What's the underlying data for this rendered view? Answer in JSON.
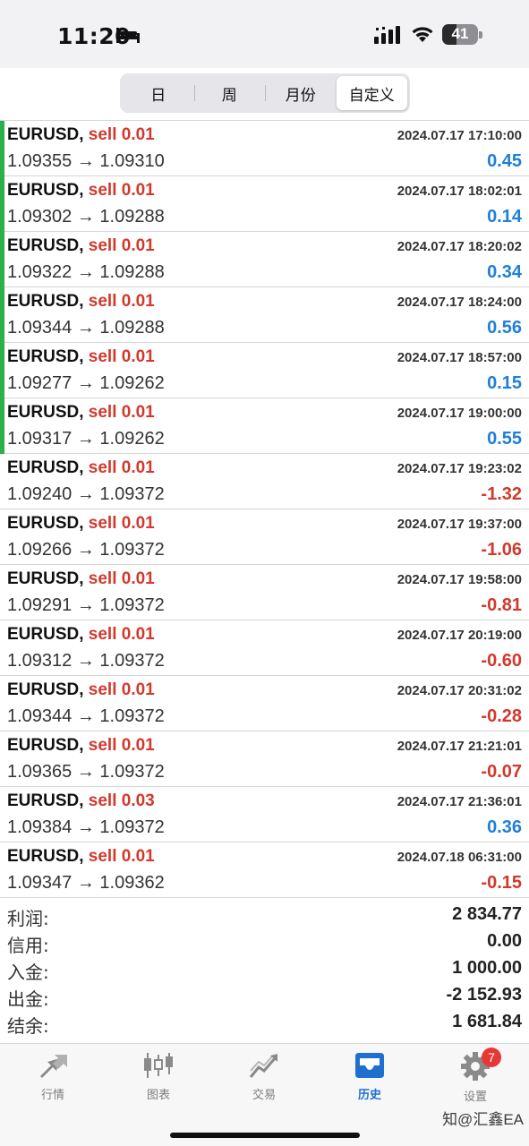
{
  "status": {
    "time": "11:20",
    "battery": "41",
    "battery_level": 0.41
  },
  "segments": [
    {
      "label": "日",
      "active": false
    },
    {
      "label": "周",
      "active": false
    },
    {
      "label": "月份",
      "active": false
    },
    {
      "label": "自定义",
      "active": true
    }
  ],
  "trades": [
    {
      "symbol": "EURUSD,",
      "side": "sell 0.01",
      "datetime": "2024.07.17 17:10:00",
      "prices": "1.09355 → 1.09310",
      "pl": "0.45",
      "profit": true
    },
    {
      "symbol": "EURUSD,",
      "side": "sell 0.01",
      "datetime": "2024.07.17 18:02:01",
      "prices": "1.09302 → 1.09288",
      "pl": "0.14",
      "profit": true
    },
    {
      "symbol": "EURUSD,",
      "side": "sell 0.01",
      "datetime": "2024.07.17 18:20:02",
      "prices": "1.09322 → 1.09288",
      "pl": "0.34",
      "profit": true
    },
    {
      "symbol": "EURUSD,",
      "side": "sell 0.01",
      "datetime": "2024.07.17 18:24:00",
      "prices": "1.09344 → 1.09288",
      "pl": "0.56",
      "profit": true
    },
    {
      "symbol": "EURUSD,",
      "side": "sell 0.01",
      "datetime": "2024.07.17 18:57:00",
      "prices": "1.09277 → 1.09262",
      "pl": "0.15",
      "profit": true
    },
    {
      "symbol": "EURUSD,",
      "side": "sell 0.01",
      "datetime": "2024.07.17 19:00:00",
      "prices": "1.09317 → 1.09262",
      "pl": "0.55",
      "profit": true
    },
    {
      "symbol": "EURUSD,",
      "side": "sell 0.01",
      "datetime": "2024.07.17 19:23:02",
      "prices": "1.09240 → 1.09372",
      "pl": "-1.32",
      "profit": false
    },
    {
      "symbol": "EURUSD,",
      "side": "sell 0.01",
      "datetime": "2024.07.17 19:37:00",
      "prices": "1.09266 → 1.09372",
      "pl": "-1.06",
      "profit": false
    },
    {
      "symbol": "EURUSD,",
      "side": "sell 0.01",
      "datetime": "2024.07.17 19:58:00",
      "prices": "1.09291 → 1.09372",
      "pl": "-0.81",
      "profit": false
    },
    {
      "symbol": "EURUSD,",
      "side": "sell 0.01",
      "datetime": "2024.07.17 20:19:00",
      "prices": "1.09312 → 1.09372",
      "pl": "-0.60",
      "profit": false
    },
    {
      "symbol": "EURUSD,",
      "side": "sell 0.01",
      "datetime": "2024.07.17 20:31:02",
      "prices": "1.09344 → 1.09372",
      "pl": "-0.28",
      "profit": false
    },
    {
      "symbol": "EURUSD,",
      "side": "sell 0.01",
      "datetime": "2024.07.17 21:21:01",
      "prices": "1.09365 → 1.09372",
      "pl": "-0.07",
      "profit": false
    },
    {
      "symbol": "EURUSD,",
      "side": "sell 0.03",
      "datetime": "2024.07.17 21:36:01",
      "prices": "1.09384 → 1.09372",
      "pl": "0.36",
      "profit": false
    },
    {
      "symbol": "EURUSD,",
      "side": "sell 0.01",
      "datetime": "2024.07.18 06:31:00",
      "prices": "1.09347 → 1.09362",
      "pl": "-0.15",
      "profit": false
    }
  ],
  "summary": [
    {
      "label": "利润:",
      "value": "2 834.77"
    },
    {
      "label": "信用:",
      "value": "0.00"
    },
    {
      "label": "入金:",
      "value": "1 000.00"
    },
    {
      "label": "出金:",
      "value": "-2 152.93"
    },
    {
      "label": "结余:",
      "value": "1 681.84"
    }
  ],
  "tabs": [
    {
      "label": "行情",
      "icon": "quotes-arrows-icon",
      "active": false
    },
    {
      "label": "图表",
      "icon": "candlestick-chart-icon",
      "active": false
    },
    {
      "label": "交易",
      "icon": "trade-chart-icon",
      "active": false
    },
    {
      "label": "历史",
      "icon": "history-inbox-icon",
      "active": true
    },
    {
      "label": "设置",
      "icon": "gear-icon",
      "active": false,
      "badge": "7"
    }
  ],
  "watermark": "知@汇鑫EA",
  "colors": {
    "sell": "#d2392c",
    "positive": "#1f7fd9",
    "negative": "#d2392c",
    "profit_bar": "#2db04b",
    "active_tab": "#1f6fd1"
  }
}
